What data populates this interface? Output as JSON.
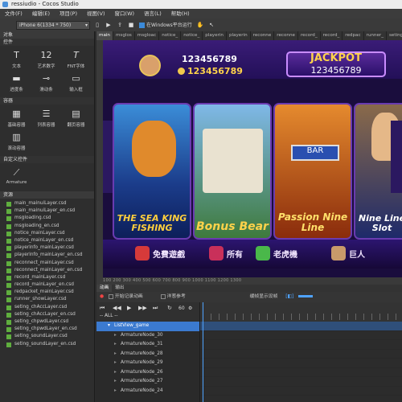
{
  "window": {
    "title": "ressiudio - Cocos Studio"
  },
  "menu": [
    "文件(F)",
    "编辑(E)",
    "项目(P)",
    "视图(V)",
    "窗口(W)",
    "语言(L)",
    "帮助(H)"
  ],
  "toolbar": {
    "device": "iPhone 6(1334 * 750)",
    "run_target": "在Windows平台运行"
  },
  "objects_panel": {
    "title": "对象",
    "controls_title": "控件",
    "controls": [
      {
        "label": "文本",
        "icon": "text-icon",
        "glyph": "T"
      },
      {
        "label": "艺术数字",
        "icon": "art-number-icon",
        "glyph": "12"
      },
      {
        "label": "FNT字体",
        "icon": "fnt-font-icon",
        "glyph": "T"
      },
      {
        "label": "进度条",
        "icon": "progress-icon",
        "glyph": "▬"
      },
      {
        "label": "滑动条",
        "icon": "slider-icon",
        "glyph": "⊸"
      },
      {
        "label": "输入框",
        "icon": "input-icon",
        "glyph": "▭"
      }
    ],
    "containers_title": "容器",
    "containers": [
      {
        "label": "基础容器",
        "icon": "panel-icon",
        "glyph": "▦"
      },
      {
        "label": "列表容器",
        "icon": "list-icon",
        "glyph": "☰"
      },
      {
        "label": "翻页容器",
        "icon": "pageview-icon",
        "glyph": "▤"
      },
      {
        "label": "滚动容器",
        "icon": "scrollview-icon",
        "glyph": "▥"
      }
    ],
    "custom_title": "自定义控件",
    "custom": [
      {
        "label": "Armature",
        "icon": "armature-icon",
        "glyph": "⟋"
      }
    ]
  },
  "resources": {
    "title": "资源",
    "files": [
      "main_mainuiLayer.csd",
      "main_mainuiLayer_en.csd",
      "msgloading.csd",
      "msgloading_en.csd",
      "notice_mainLayer.csd",
      "notice_mainLayer_en.csd",
      "playerinfo_mainLayer.csd",
      "playerinfo_mainLayer_en.csd",
      "reconnect_mainLayer.csd",
      "reconnect_mainLayer_en.csd",
      "record_mainLayer.csd",
      "record_mainLayer_en.csd",
      "redpacket_mainLayer.csd",
      "runner_showLayer.csd",
      "seting_chAccLayer.csd",
      "seting_chAccLayer_en.csd",
      "seting_chpwdLayer.csd",
      "seting_chpwdLayer_en.csd",
      "seting_soundLayer.csd",
      "seting_soundLayer_en.csd"
    ]
  },
  "doc_tabs": [
    "main",
    "msglos",
    "msgloac",
    "notice_",
    "notice_",
    "playerin",
    "playerin",
    "reconne",
    "reconne",
    "record_",
    "record_",
    "redpac",
    "runner_",
    "seting_",
    "seting_"
  ],
  "game": {
    "credits_top": "123456789",
    "credits_bottom": "123456789",
    "jackpot_label": "JACKPOT",
    "jackpot_value": "123456789",
    "games": [
      "THE SEA KING FISHING",
      "Bonus Bear",
      "Passion Nine Line",
      "Nine Line Slot"
    ],
    "nav": [
      "免費遊戲",
      "所有",
      "老虎機",
      "巨人"
    ]
  },
  "ruler_labels": "100 200 300 400 500 600 700 800 900 1000 1100 1200 1300",
  "anim_panel": {
    "tabs": [
      "动画",
      "输出"
    ],
    "record_label": "开始记录动画",
    "onion_label": "洋葱参考",
    "loop_label": "缓帧显示设帧",
    "fps": "60",
    "filter": "-- ALL --"
  },
  "tree": {
    "root": "ListView_game",
    "children": [
      "ArmatureNode_30",
      "ArmatureNode_31",
      "ArmatureNode_28",
      "ArmatureNode_29",
      "ArmatureNode_26",
      "ArmatureNode_27",
      "ArmatureNode_24"
    ]
  },
  "colors": {
    "accent": "#3b7ad0",
    "file_icon": "#5fae3e"
  }
}
